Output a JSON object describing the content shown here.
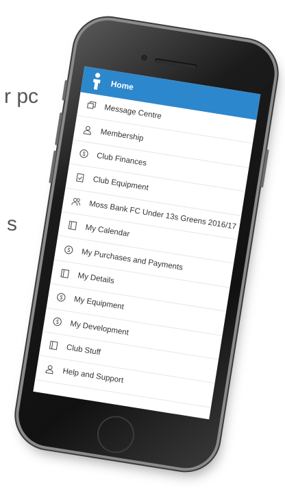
{
  "background": {
    "text_1": "r pc",
    "text_2": "s"
  },
  "app": {
    "header_title": "Home",
    "accent_color": "#2d87cc",
    "logo_icon": "person-logo-icon",
    "menu": [
      {
        "label": "Message Centre",
        "icon": "messages-icon"
      },
      {
        "label": "Membership",
        "icon": "person-icon"
      },
      {
        "label": "Club Finances",
        "icon": "coin-icon"
      },
      {
        "label": "Club Equipment",
        "icon": "clipboard-check-icon"
      },
      {
        "label": "Moss Bank FC Under 13s Greens 2016/17",
        "icon": "team-icon"
      },
      {
        "label": "My Calendar",
        "icon": "book-icon"
      },
      {
        "label": "My Purchases and Payments",
        "icon": "coin-icon"
      },
      {
        "label": "My Details",
        "icon": "book-icon"
      },
      {
        "label": "My Equipment",
        "icon": "coin-icon"
      },
      {
        "label": "My Development",
        "icon": "coin-icon"
      },
      {
        "label": "Club Stuff",
        "icon": "book-icon"
      },
      {
        "label": "Help and Support",
        "icon": "person-icon"
      }
    ]
  }
}
